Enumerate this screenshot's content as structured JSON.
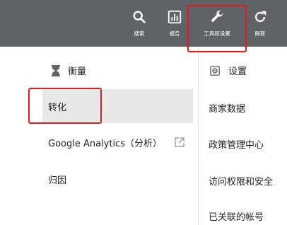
{
  "toolbar": {
    "search_label": "搜索",
    "reports_label": "报告",
    "tools_label": "工具和设置",
    "refresh_label": "刷新",
    "icon_color": "#ffffff",
    "background": "#5f6368"
  },
  "measurement": {
    "heading": "衡量",
    "icon": "hourglass-icon",
    "items": [
      {
        "label": "转化",
        "active": true
      },
      {
        "label": "Google Analytics（分析）",
        "external": true
      },
      {
        "label": "归因"
      }
    ]
  },
  "settings": {
    "heading": "设置",
    "icon": "gear-icon",
    "items": [
      {
        "label": "商家数据"
      },
      {
        "label": "政策管理中心"
      },
      {
        "label": "访问权限和安全"
      },
      {
        "label": "已关联的帐号"
      }
    ]
  },
  "annotation_color": "#e01b1b"
}
